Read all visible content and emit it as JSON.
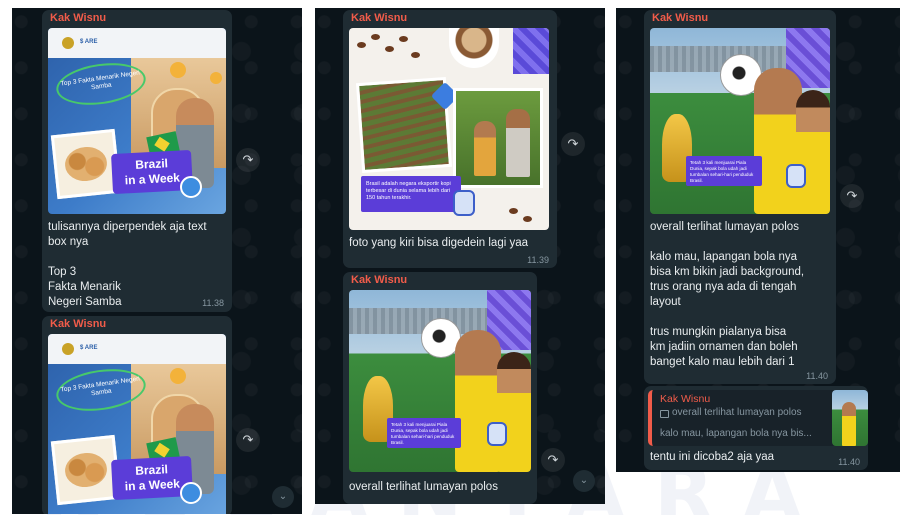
{
  "watermark": "NUSANTARA",
  "sender": "Kak Wisnu",
  "forward_glyph": "↷",
  "scroll_glyph": "⌄",
  "panel1": {
    "image_tagline": "Top 3 Fakta Menarik Negeri Samba",
    "image_badge_line1": "Brazil",
    "image_badge_line2": "in a Week",
    "image_logo_text": "$ ARE",
    "message": "tulisannya diperpendek aja text\nbox nya\n\nTop 3\nFakta Menarik\nNegeri Samba",
    "time": "11.38"
  },
  "panel2": {
    "coffee_caption": "Brasil adalah negara eksportir kopi terbesar di dunia selama lebih dari 150 tahun terakhir.",
    "message_coffee": "foto yang kiri bisa digedein lagi yaa",
    "time_coffee": "11.39",
    "football_caption": "Tetah 3 kali menjuarai Piala Dunia, sepak bola udah jadi tumbalan sehari-hari penduduk Brasil.",
    "message_football": "overall terlihat lumayan polos"
  },
  "panel3": {
    "football_caption": "Tetah 3 kali menjuarai Piala Dunia, sepak bola udah jadi tumbalan sehari-hari penduduk Brasil.",
    "message": "overall terlihat lumayan polos\n\nkalo mau, lapangan bola nya\nbisa km bikin jadi background,\ntrus orang nya ada di tengah\nlayout\n\ntrus mungkin pialanya bisa\nkm jadiin ornamen dan boleh\nbanget kalo mau lebih dari 1",
    "time": "11.40",
    "quote_sender": "Kak Wisnu",
    "quote_line1": "overall terlihat lumayan polos",
    "quote_line2": "kalo mau, lapangan bola nya bis...",
    "reply_message": "tentu ini dicoba2 aja yaa",
    "reply_time": "11.40"
  }
}
